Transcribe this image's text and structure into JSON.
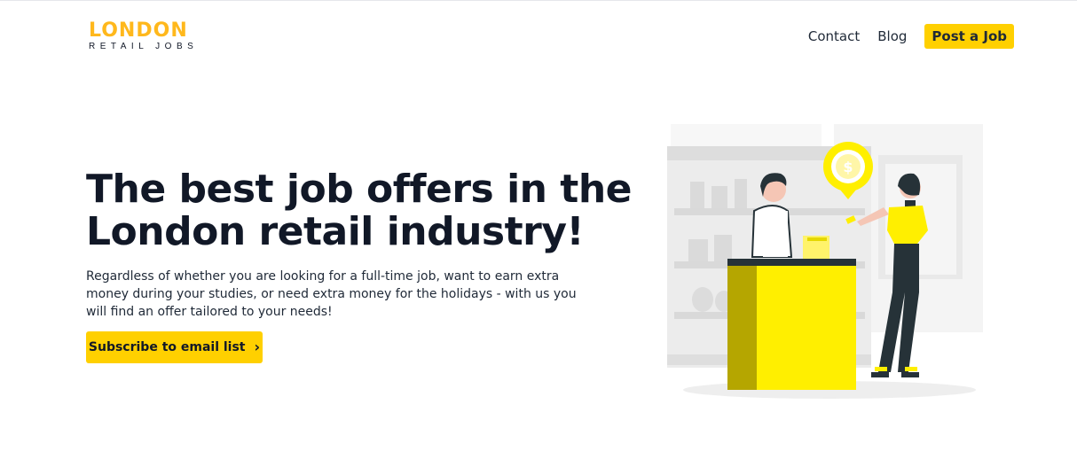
{
  "logo": {
    "line1": "LONDON",
    "line2": "RETAIL JOBS"
  },
  "nav": {
    "contact": "Contact",
    "blog": "Blog",
    "post_job": "Post a Job"
  },
  "hero": {
    "title": "The best job offers in the London retail industry!",
    "text": "Regardless of whether you are looking for a full-time job, want to earn extra money during your studies, or need extra money for the holidays - with us you will find an offer tailored to your needs!",
    "cta": "Subscribe to email list"
  },
  "illustration": {
    "pin_symbol": "$"
  },
  "colors": {
    "accent": "#FFD000",
    "logo": "#FFB81C",
    "text": "#111827",
    "illustration_dark": "#263238"
  },
  "icons": {
    "cta_icon": "chevron-right-icon"
  }
}
